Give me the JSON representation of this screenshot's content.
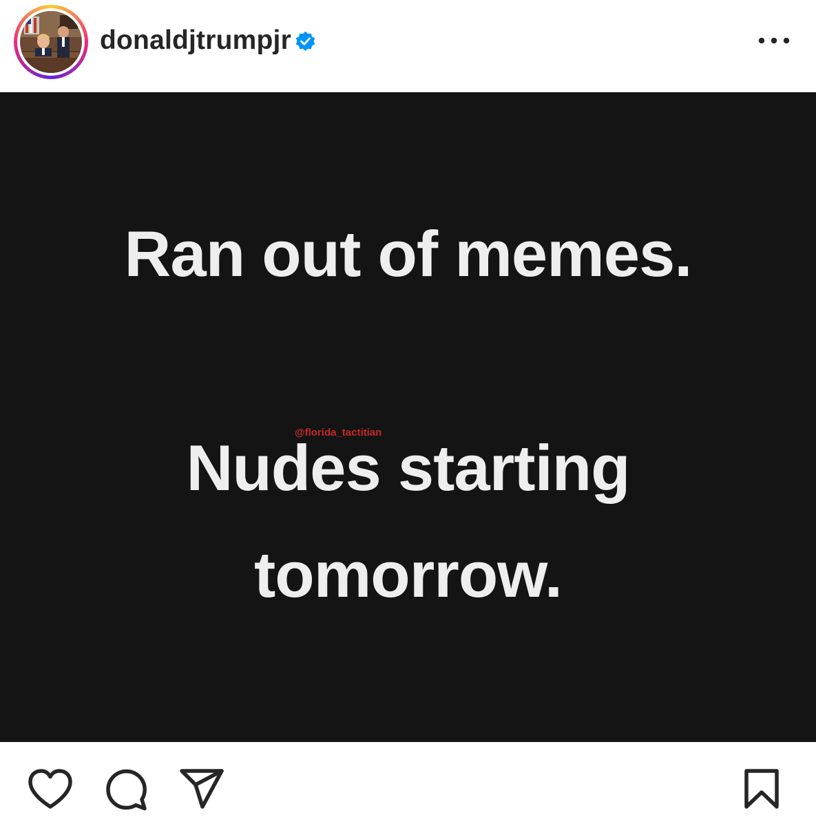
{
  "post": {
    "username": "donaldjtrumpjr",
    "verified": true,
    "avatar_icon": "profile-photo",
    "more_icon": "more-options-icon"
  },
  "meme": {
    "line1": "Ran out of memes.",
    "line2": "Nudes starting",
    "line3": "tomorrow.",
    "watermark": "@florida_tactitian"
  },
  "actions": {
    "like_icon": "heart-icon",
    "comment_icon": "comment-icon",
    "share_icon": "share-icon",
    "save_icon": "bookmark-icon"
  },
  "colors": {
    "background": "#ffffff",
    "text": "#262626",
    "verified_badge": "#0095f6",
    "image_background": "#141414",
    "meme_text": "#eeeeee",
    "watermark": "#c62828"
  }
}
